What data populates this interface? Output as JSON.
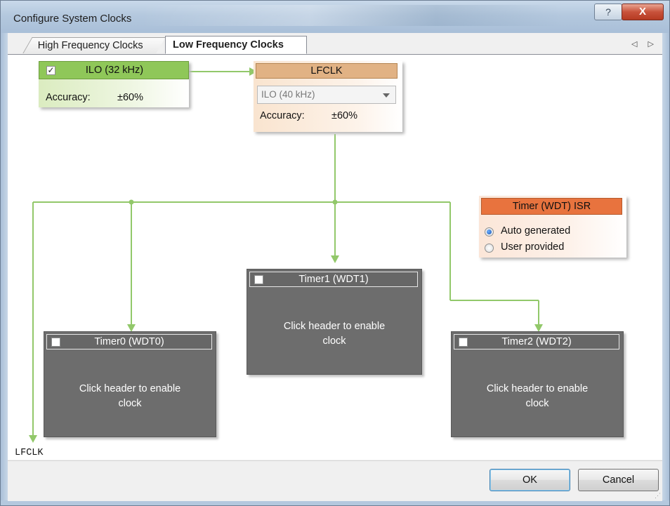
{
  "window": {
    "title": "Configure System Clocks",
    "help_label": "?",
    "close_label": "X"
  },
  "tabs": [
    {
      "label": "High Frequency Clocks",
      "active": false
    },
    {
      "label": "Low Frequency Clocks",
      "active": true
    }
  ],
  "tab_scroll_label": "◁ ▷",
  "ilo": {
    "checked": true,
    "checkmark": "✓",
    "title": "ILO (32 kHz)",
    "accuracy_label": "Accuracy:",
    "accuracy_value": "±60%"
  },
  "lfclk": {
    "title": "LFCLK",
    "source_value": "ILO (40 kHz)",
    "accuracy_label": "Accuracy:",
    "accuracy_value": "±60%"
  },
  "timer_isr": {
    "title": "Timer (WDT) ISR",
    "options": [
      {
        "label": "Auto generated",
        "selected": true
      },
      {
        "label": "User provided",
        "selected": false
      }
    ]
  },
  "timers": [
    {
      "title": "Timer0 (WDT0)",
      "checked": false,
      "message_line1": "Click header to enable",
      "message_line2": "clock"
    },
    {
      "title": "Timer1 (WDT1)",
      "checked": false,
      "message_line1": "Click header to enable",
      "message_line2": "clock"
    },
    {
      "title": "Timer2 (WDT2)",
      "checked": false,
      "message_line1": "Click header to enable",
      "message_line2": "clock"
    }
  ],
  "lfclk_output_label": "LFCLK",
  "buttons": {
    "ok": "OK",
    "cancel": "Cancel"
  },
  "colors": {
    "ilo_header": "#8fc759",
    "lfclk_header": "#e1b284",
    "isr_header": "#e8733e",
    "timer_disabled": "#6d6d6d",
    "wire": "#92c86a"
  }
}
